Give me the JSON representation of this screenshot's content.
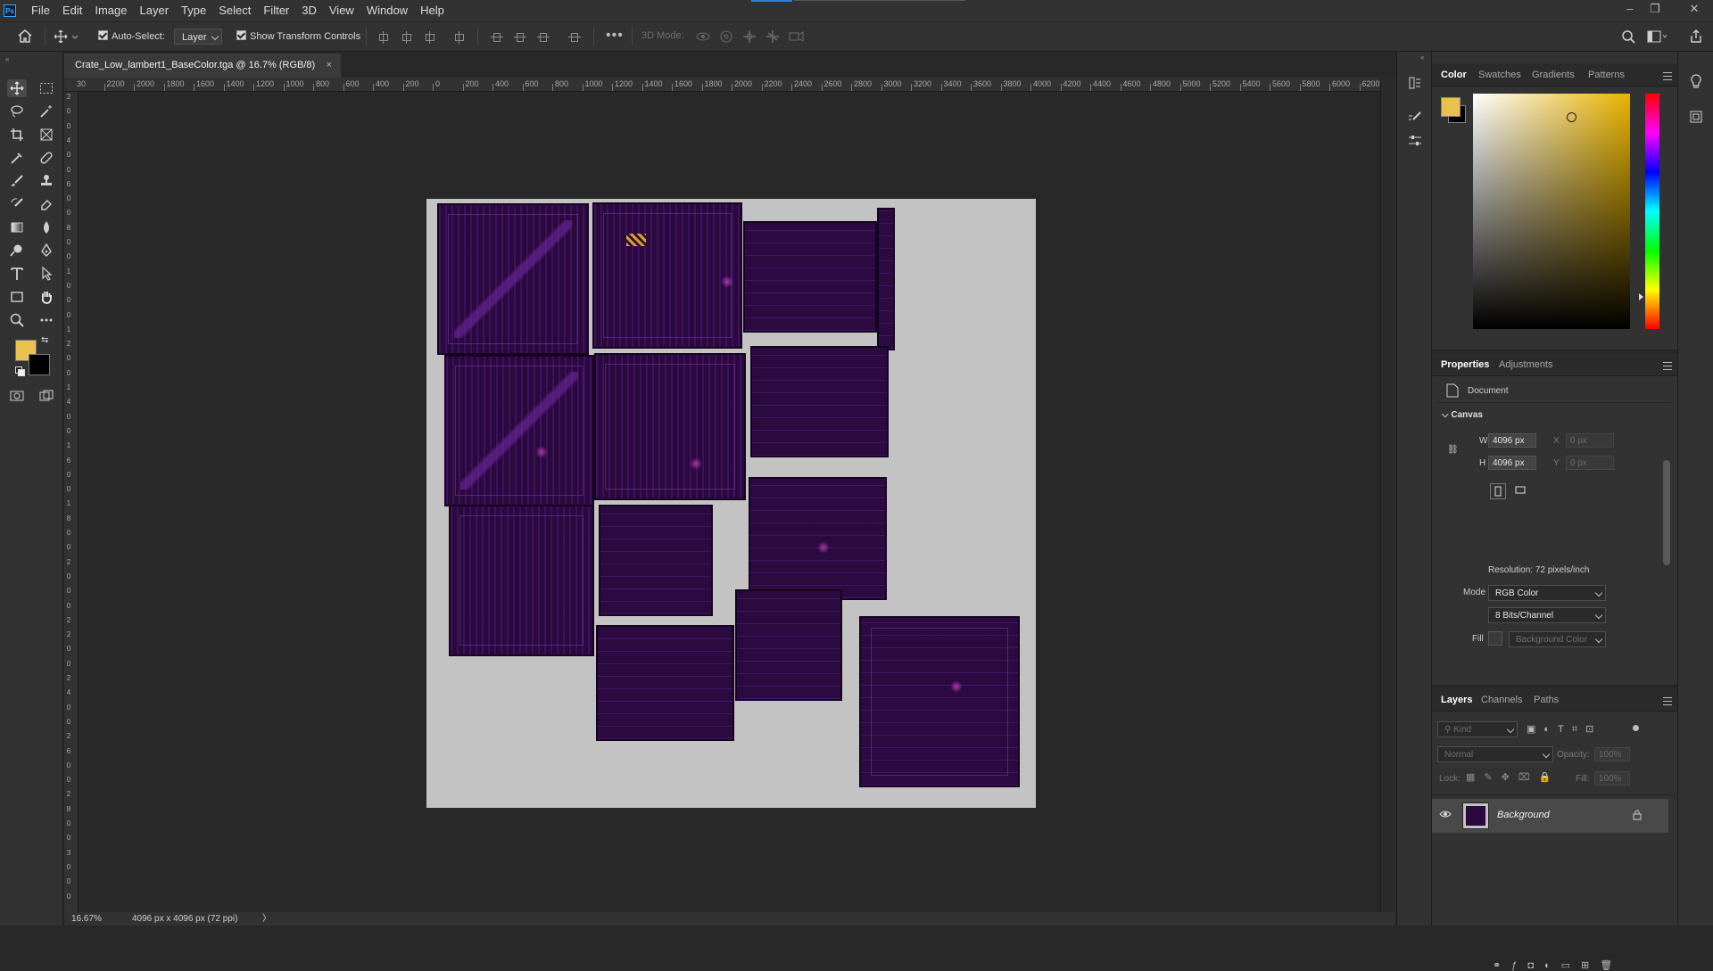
{
  "app": {
    "logo": "Ps"
  },
  "menu": [
    "File",
    "Edit",
    "Image",
    "Layer",
    "Type",
    "Select",
    "Filter",
    "3D",
    "View",
    "Window",
    "Help"
  ],
  "options": {
    "auto_select_label": "Auto-Select:",
    "auto_select_target": "Layer",
    "show_transform_label": "Show Transform Controls",
    "mode_3d_label": "3D Mode:"
  },
  "document": {
    "tab_title": "Crate_Low_lambert1_BaseColor.tga @ 16.7% (RGB/8)",
    "close": "×"
  },
  "ruler_h": [
    "30",
    "2200",
    "2000",
    "1800",
    "1600",
    "1400",
    "1200",
    "1000",
    "800",
    "600",
    "400",
    "200",
    "0",
    "200",
    "400",
    "600",
    "800",
    "1000",
    "1200",
    "1400",
    "1600",
    "1800",
    "2000",
    "2200",
    "2400",
    "2600",
    "2800",
    "3000",
    "3200",
    "3400",
    "3600",
    "3800",
    "4000",
    "4200",
    "4400",
    "4600",
    "4800",
    "5000",
    "5200",
    "5400",
    "5600",
    "5800",
    "6000",
    "6200"
  ],
  "ruler_v": [
    "2",
    "0",
    "0",
    "4",
    "0",
    "0",
    "6",
    "0",
    "0",
    "8",
    "0",
    "0",
    "1",
    "0",
    "0",
    "0",
    "1",
    "2",
    "0",
    "0",
    "1",
    "4",
    "0",
    "0",
    "1",
    "6",
    "0",
    "0",
    "1",
    "8",
    "0",
    "0",
    "2",
    "0",
    "0",
    "0",
    "2",
    "2",
    "0",
    "0",
    "2",
    "4",
    "0",
    "0",
    "2",
    "6",
    "0",
    "0",
    "2",
    "8",
    "0",
    "0",
    "3",
    "0",
    "0",
    "0"
  ],
  "status": {
    "zoom": "16.67%",
    "doc_info": "4096 px x 4096 px (72 ppi)",
    "arrow": "〉"
  },
  "colors": {
    "foreground": "#e8c14f",
    "background": "#000000",
    "canvas_bg": "#c3c3c3",
    "texture": "#2a0a3d"
  },
  "color_panel": {
    "tabs": [
      "Color",
      "Swatches",
      "Gradients",
      "Patterns"
    ]
  },
  "properties_panel": {
    "tabs": [
      "Properties",
      "Adjustments"
    ],
    "doc_label": "Document",
    "section": "Canvas",
    "w_label": "W",
    "w_value": "4096 px",
    "h_label": "H",
    "h_value": "4096 px",
    "x_label": "X",
    "x_value": "0 px",
    "y_label": "Y",
    "y_value": "0 px",
    "resolution": "Resolution: 72 pixels/inch",
    "mode_label": "Mode",
    "mode_value": "RGB Color",
    "bits_value": "8 Bits/Channel",
    "fill_label": "Fill",
    "fill_value": "Background Color"
  },
  "layers_panel": {
    "tabs": [
      "Layers",
      "Channels",
      "Paths"
    ],
    "kind_placeholder": "Kind",
    "blend_mode": "Normal",
    "opacity_label": "Opacity:",
    "opacity_value": "100%",
    "lock_label": "Lock:",
    "fill_label": "Fill:",
    "fill_value": "100%",
    "layers": [
      {
        "name": "Background"
      }
    ]
  }
}
